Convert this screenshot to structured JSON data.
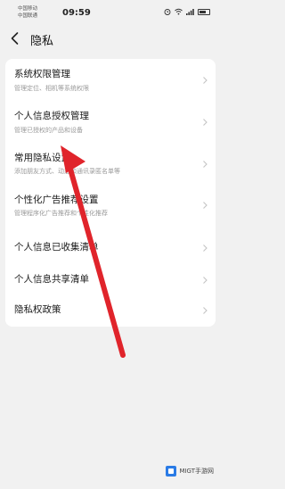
{
  "status_bar": {
    "carrier_line1": "中国移动",
    "carrier_line2": "中国联通",
    "time": "09:59",
    "icons": [
      "alarm-icon",
      "wifi-icon",
      "signal-icon",
      "battery-icon"
    ]
  },
  "header": {
    "back_icon": "chevron-left-icon",
    "title": "隐私"
  },
  "card1": {
    "items": [
      {
        "title": "系统权限管理",
        "subtitle": "管理定位、相机等系统权限"
      },
      {
        "title": "个人信息授权管理",
        "subtitle": "管理已授权的产品和设备"
      },
      {
        "title": "常用隐私设置",
        "subtitle": "添加朋友方式、动态和通讯录匿名单等"
      },
      {
        "title": "个性化广告推荐设置",
        "subtitle": "管理程序化广告推荐和个性化推荐"
      },
      {
        "title": "个人信息已收集清单",
        "subtitle": ""
      },
      {
        "title": "个人信息共享清单",
        "subtitle": ""
      },
      {
        "title": "隐私权政策",
        "subtitle": ""
      }
    ]
  },
  "overlay": {
    "arrow_color": "#e0242b"
  },
  "watermark": {
    "text": "MIGT手游网"
  },
  "colors": {
    "background": "#f1f1f1",
    "card": "#ffffff",
    "arrow": "#e0242b"
  }
}
